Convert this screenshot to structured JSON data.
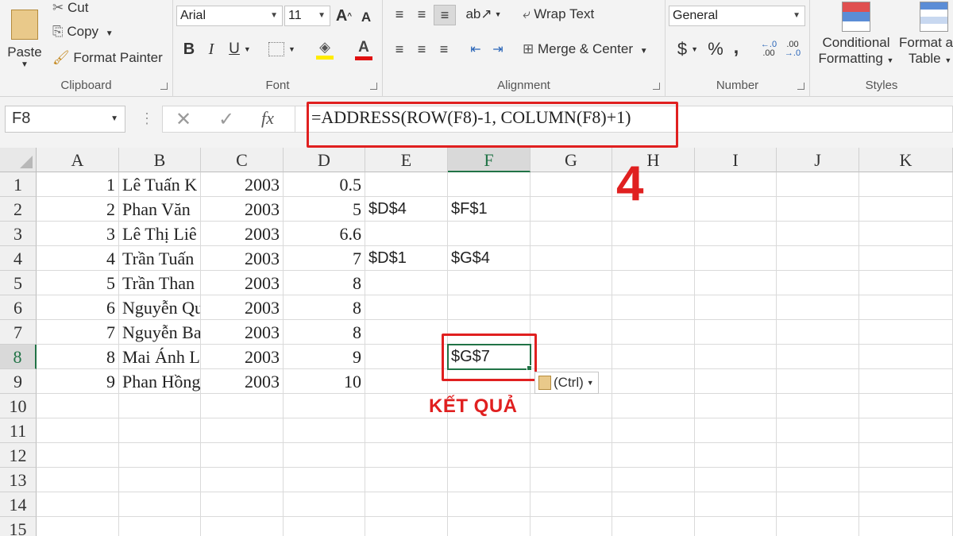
{
  "ribbon": {
    "clipboard": {
      "label": "Clipboard",
      "paste": "Paste",
      "cut": "Cut",
      "copy": "Copy",
      "format_painter": "Format Painter"
    },
    "font": {
      "label": "Font",
      "font_name": "Arial",
      "font_size": "11",
      "bold": "B",
      "italic": "I",
      "underline": "U"
    },
    "alignment": {
      "label": "Alignment",
      "wrap_text": "Wrap Text",
      "merge_center": "Merge & Center"
    },
    "number": {
      "label": "Number",
      "format": "General",
      "currency": "$",
      "percent": "%",
      "comma": ","
    },
    "styles": {
      "label": "Styles",
      "conditional_1": "Conditional",
      "conditional_2": "Formatting",
      "format_as_1": "Format a",
      "format_as_2": "Table"
    }
  },
  "formula_bar": {
    "name_box": "F8",
    "fx": "fx",
    "formula": "=ADDRESS(ROW(F8)-1, COLUMN(F8)+1)"
  },
  "grid": {
    "columns": [
      "A",
      "B",
      "C",
      "D",
      "E",
      "F",
      "G",
      "H",
      "I",
      "J",
      "K"
    ],
    "rows": [
      "1",
      "2",
      "3",
      "4",
      "5",
      "6",
      "7",
      "8",
      "9",
      "10",
      "11",
      "12",
      "13",
      "14",
      "15"
    ],
    "data": [
      {
        "a": "1",
        "b": "Lê Tuấn K",
        "c": "2003",
        "d": "0.5",
        "e": "",
        "f": ""
      },
      {
        "a": "2",
        "b": "Phan Văn",
        "c": "2003",
        "d": "5",
        "e": "$D$4",
        "f": "$F$1"
      },
      {
        "a": "3",
        "b": "Lê Thị Liê",
        "c": "2003",
        "d": "6.6",
        "e": "",
        "f": ""
      },
      {
        "a": "4",
        "b": "Trần Tuấn",
        "c": "2003",
        "d": "7",
        "e": "$D$1",
        "f": "$G$4"
      },
      {
        "a": "5",
        "b": "Trần Than",
        "c": "2003",
        "d": "8",
        "e": "",
        "f": ""
      },
      {
        "a": "6",
        "b": "Nguyễn Qu",
        "c": "2003",
        "d": "8",
        "e": "",
        "f": ""
      },
      {
        "a": "7",
        "b": "Nguyễn Ba",
        "c": "2003",
        "d": "8",
        "e": "",
        "f": ""
      },
      {
        "a": "8",
        "b": "Mai Ánh L",
        "c": "2003",
        "d": "9",
        "e": "",
        "f": "$G$7"
      },
      {
        "a": "9",
        "b": "Phan Hồng",
        "c": "2003",
        "d": "10",
        "e": "",
        "f": ""
      }
    ]
  },
  "paste_options": "(Ctrl)",
  "annotations": {
    "step_number": "4",
    "result_label": "KẾT QUẢ"
  },
  "colors": {
    "excel_green": "#217346",
    "annotation_red": "#e02020"
  }
}
